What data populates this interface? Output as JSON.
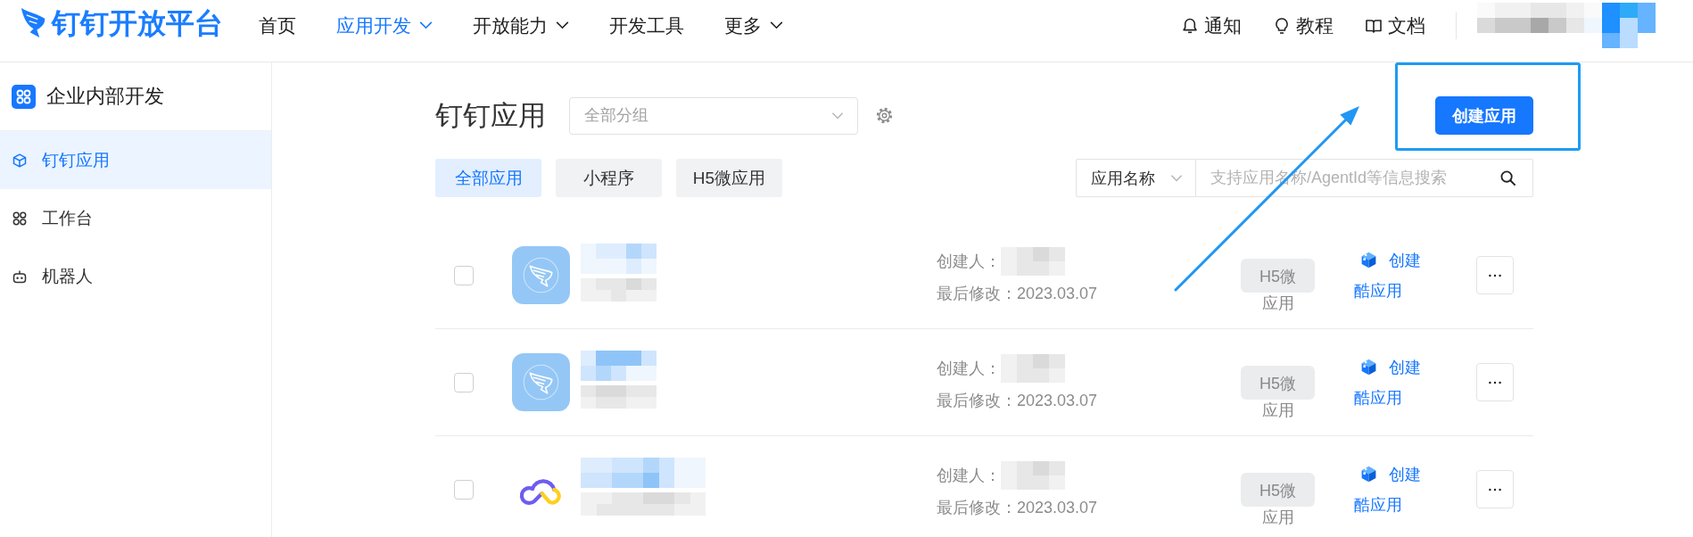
{
  "header": {
    "logo": "钉钉开放平台",
    "nav": [
      {
        "label": "首页",
        "selected": false,
        "has_menu": false
      },
      {
        "label": "应用开发",
        "selected": true,
        "has_menu": true
      },
      {
        "label": "开放能力",
        "selected": false,
        "has_menu": true
      },
      {
        "label": "开发工具",
        "selected": false,
        "has_menu": false
      },
      {
        "label": "更多",
        "selected": false,
        "has_menu": true
      }
    ],
    "links": [
      {
        "label": "通知"
      },
      {
        "label": "教程"
      },
      {
        "label": "文档"
      }
    ],
    "account": {
      "redacted": true
    }
  },
  "sidebar": {
    "title": "企业内部开发",
    "items": [
      {
        "label": "钉钉应用",
        "selected": true
      },
      {
        "label": "工作台",
        "selected": false
      },
      {
        "label": "机器人",
        "selected": false
      }
    ]
  },
  "main": {
    "title": "钉钉应用",
    "group_select": {
      "placeholder": "全部分组"
    },
    "create_button": {
      "label": "创建应用",
      "highlighted": true
    },
    "filters": [
      {
        "label": "全部应用",
        "selected": true
      },
      {
        "label": "小程序",
        "selected": false
      },
      {
        "label": "H5微应用",
        "selected": false
      }
    ],
    "search": {
      "scope": "应用名称",
      "placeholder": "支持应用名称/AgentId等信息搜索"
    },
    "apps": [
      {
        "kind": "default",
        "checked": false,
        "redacted": true,
        "creator_label": "创建人：",
        "modified": "最后修改：2023.03.07",
        "type": "H5微应用",
        "action": "创建酷应用"
      },
      {
        "kind": "default",
        "checked": false,
        "redacted": true,
        "creator_label": "创建人：",
        "modified": "最后修改：2023.03.07",
        "type": "H5微应用",
        "action": "创建酷应用"
      },
      {
        "kind": "custom",
        "checked": false,
        "redacted": true,
        "creator_label": "创建人：",
        "modified": "最后修改：2023.03.07",
        "type": "H5微应用",
        "action": "创建酷应用"
      }
    ]
  }
}
